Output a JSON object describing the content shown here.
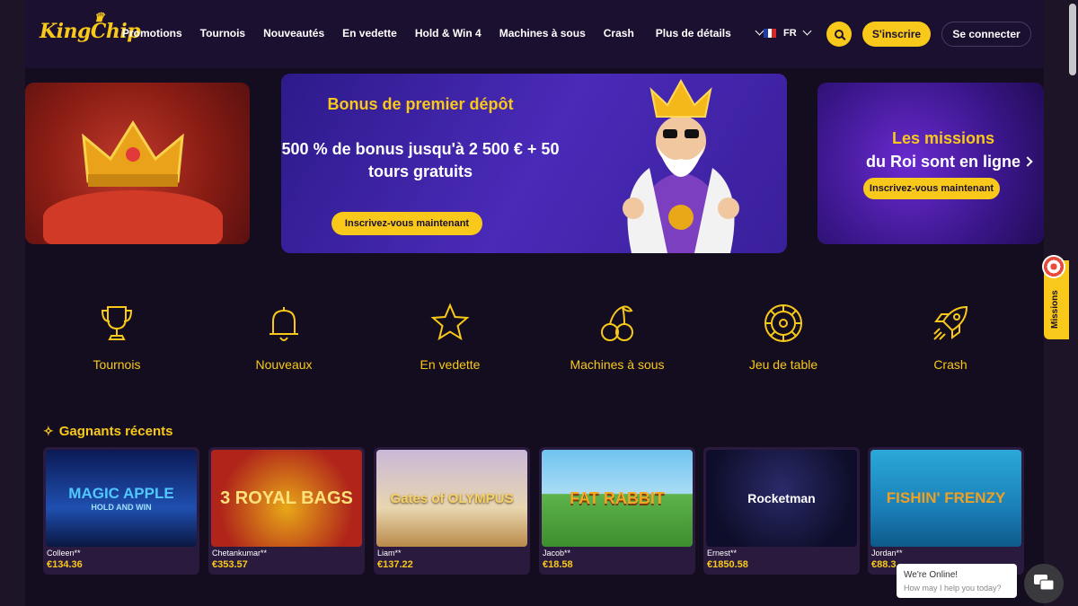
{
  "header": {
    "logo": "KingChip",
    "nav": [
      "Promotions",
      "Tournois",
      "Nouveautés",
      "En vedette",
      "Hold & Win 4",
      "Machines à sous",
      "Crash"
    ],
    "more": "Plus de détails",
    "lang": "FR",
    "signup": "S'inscrire",
    "login": "Se connecter"
  },
  "banners": {
    "main": {
      "title_yellow": "Bonus de premier dépôt",
      "title_white": "500 % de bonus jusqu'à 2 500 € + 50 tours gratuits",
      "cta": "Inscrivez-vous maintenant"
    },
    "right": {
      "title_yellow": "Les missions",
      "title_white": "du Roi sont en ligne",
      "cta": "Inscrivez-vous maintenant"
    }
  },
  "categories": [
    {
      "label": "Tournois",
      "icon": "trophy-icon"
    },
    {
      "label": "Nouveaux",
      "icon": "bell-icon"
    },
    {
      "label": "En vedette",
      "icon": "star-icon"
    },
    {
      "label": "Machines à sous",
      "icon": "cherries-icon"
    },
    {
      "label": "Jeu de table",
      "icon": "roulette-icon"
    },
    {
      "label": "Crash",
      "icon": "rocket-icon"
    }
  ],
  "winners": {
    "title": "Gagnants récents",
    "items": [
      {
        "game": "MAGIC APPLE",
        "sub": "HOLD AND WIN",
        "user": "Colleen**",
        "amount": "€134.36"
      },
      {
        "game": "3 ROYAL BAGS",
        "sub": "",
        "user": "Chetankumar**",
        "amount": "€353.57"
      },
      {
        "game": "Gates of OLYMPUS",
        "sub": "",
        "user": "Liam**",
        "amount": "€137.22"
      },
      {
        "game": "FAT RABBIT",
        "sub": "",
        "user": "Jacob**",
        "amount": "€18.58"
      },
      {
        "game": "Rocketman",
        "sub": "",
        "user": "Ernest**",
        "amount": "€1850.58"
      },
      {
        "game": "FISHIN' FRENZY",
        "sub": "",
        "user": "Jordan**",
        "amount": "€88.3"
      }
    ]
  },
  "side_tab": {
    "label": "Missions"
  },
  "chat": {
    "line1": "We're Online!",
    "line2": "How may I help you today?"
  },
  "colors": {
    "accent": "#f8c91a",
    "background": "#140d1f",
    "header": "#1c1030"
  }
}
